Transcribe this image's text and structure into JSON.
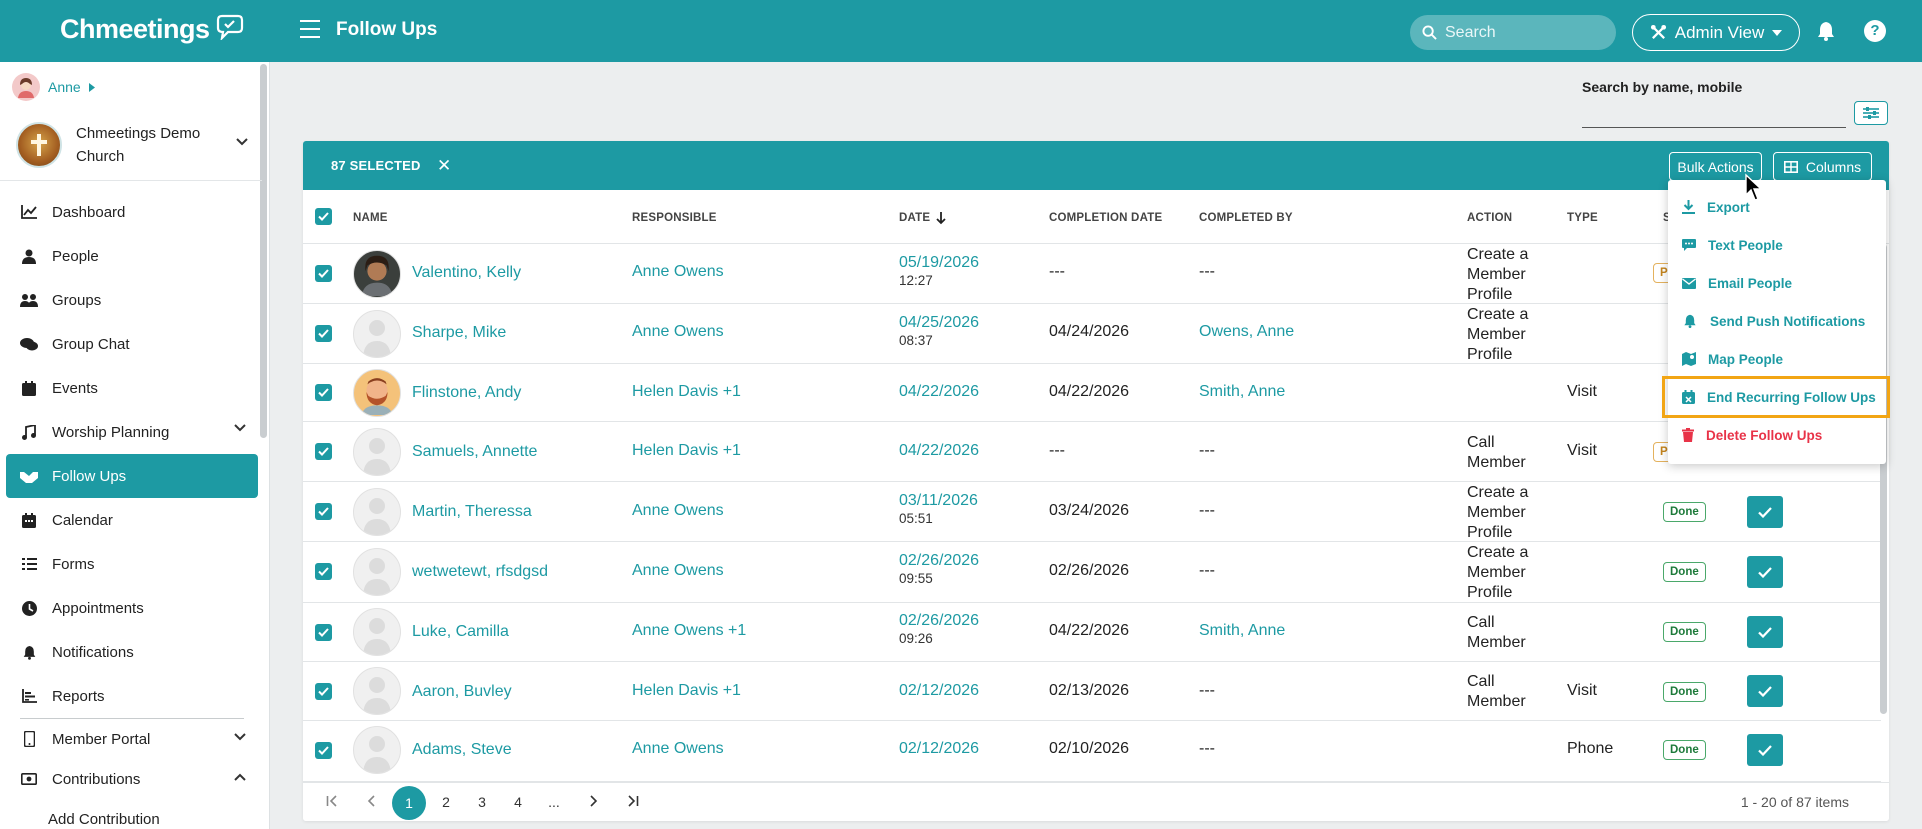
{
  "header": {
    "logo": "Chmeetings",
    "title": "Follow Ups",
    "search_placeholder": "Search",
    "admin_view": "Admin View",
    "help": "?"
  },
  "sidebar": {
    "user": "Anne",
    "church": "Chmeetings Demo Church",
    "items": [
      {
        "label": "Dashboard",
        "icon": "chart-line-icon"
      },
      {
        "label": "People",
        "icon": "person-icon"
      },
      {
        "label": "Groups",
        "icon": "groups-icon"
      },
      {
        "label": "Group Chat",
        "icon": "chat-icon"
      },
      {
        "label": "Events",
        "icon": "calendar-icon"
      },
      {
        "label": "Worship Planning",
        "icon": "music-note-icon"
      },
      {
        "label": "Follow Ups",
        "icon": "handshake-icon"
      },
      {
        "label": "Calendar",
        "icon": "calendar-icon"
      },
      {
        "label": "Forms",
        "icon": "list-icon"
      },
      {
        "label": "Appointments",
        "icon": "clock-icon"
      },
      {
        "label": "Notifications",
        "icon": "bell-icon"
      },
      {
        "label": "Reports",
        "icon": "bar-chart-icon"
      },
      {
        "label": "Member Portal",
        "icon": "mobile-icon"
      },
      {
        "label": "Contributions",
        "icon": "money-icon"
      }
    ],
    "sub_item": "Add Contribution"
  },
  "filter": {
    "label": "Search by name, mobile",
    "value": ""
  },
  "table": {
    "selected": "87 SELECTED",
    "bulk_actions": "Bulk Actions",
    "columns_btn": "Columns",
    "headers": [
      "NAME",
      "RESPONSIBLE",
      "DATE",
      "COMPLETION DATE",
      "COMPLETED BY",
      "ACTION",
      "TYPE",
      "S"
    ],
    "rows": [
      {
        "name": "Valentino, Kelly",
        "resp": "Anne Owens",
        "date": "05/19/2026",
        "time": "12:27",
        "comp_date": "---",
        "comp_by": "---",
        "action": "Create a Member Profile",
        "type": "",
        "status": "P"
      },
      {
        "name": "Sharpe, Mike",
        "resp": "Anne Owens",
        "date": "04/25/2026",
        "time": "08:37",
        "comp_date": "04/24/2026",
        "comp_by": "Owens, Anne",
        "action": "Create a Member Profile",
        "type": "",
        "status": ""
      },
      {
        "name": "Flinstone, Andy",
        "resp": "Helen Davis  +1",
        "date": "04/22/2026",
        "time": "",
        "comp_date": "04/22/2026",
        "comp_by": "Smith, Anne",
        "action": "",
        "type": "Visit",
        "status": ""
      },
      {
        "name": "Samuels, Annette",
        "resp": "Helen Davis  +1",
        "date": "04/22/2026",
        "time": "",
        "comp_date": "---",
        "comp_by": "---",
        "action": "Call Member",
        "type": "Visit",
        "status": "P"
      },
      {
        "name": "Martin, Theressa",
        "resp": "Anne Owens",
        "date": "03/11/2026",
        "time": "05:51",
        "comp_date": "03/24/2026",
        "comp_by": "---",
        "action": "Create a Member Profile",
        "type": "",
        "status": "Done"
      },
      {
        "name": "wetwetewt, rfsdgsd",
        "resp": "Anne Owens",
        "date": "02/26/2026",
        "time": "09:55",
        "comp_date": "02/26/2026",
        "comp_by": "---",
        "action": "Create a Member Profile",
        "type": "",
        "status": "Done"
      },
      {
        "name": "Luke, Camilla",
        "resp": "Anne Owens  +1",
        "date": "02/26/2026",
        "time": "09:26",
        "comp_date": "04/22/2026",
        "comp_by": "Smith, Anne",
        "action": "Call Member",
        "type": "",
        "status": "Done"
      },
      {
        "name": "Aaron, Buvley",
        "resp": "Helen Davis  +1",
        "date": "02/12/2026",
        "time": "",
        "comp_date": "02/13/2026",
        "comp_by": "---",
        "action": "Call Member",
        "type": "Visit",
        "status": "Done"
      },
      {
        "name": "Adams, Steve",
        "resp": "Anne Owens",
        "date": "02/12/2026",
        "time": "",
        "comp_date": "02/10/2026",
        "comp_by": "---",
        "action": "",
        "type": "Phone",
        "status": "Done"
      }
    ]
  },
  "pager": {
    "pages": [
      "1",
      "2",
      "3",
      "4",
      "..."
    ],
    "info": "1 - 20 of 87 items"
  },
  "menu": {
    "items": [
      {
        "label": "Export",
        "icon": "download-icon"
      },
      {
        "label": "Text People",
        "icon": "sms-icon"
      },
      {
        "label": "Email People",
        "icon": "envelope-icon"
      },
      {
        "label": "Send Push Notifications",
        "icon": "bell-icon"
      },
      {
        "label": "Map People",
        "icon": "map-icon"
      },
      {
        "label": "End Recurring Follow Ups",
        "icon": "calendar-x-icon"
      },
      {
        "label": "Delete Follow Ups",
        "icon": "trash-icon"
      }
    ]
  },
  "colors": {
    "primary": "#1d9aa3",
    "danger": "#e83348",
    "highlight": "#f2a514",
    "done": "#1d7a3a"
  }
}
